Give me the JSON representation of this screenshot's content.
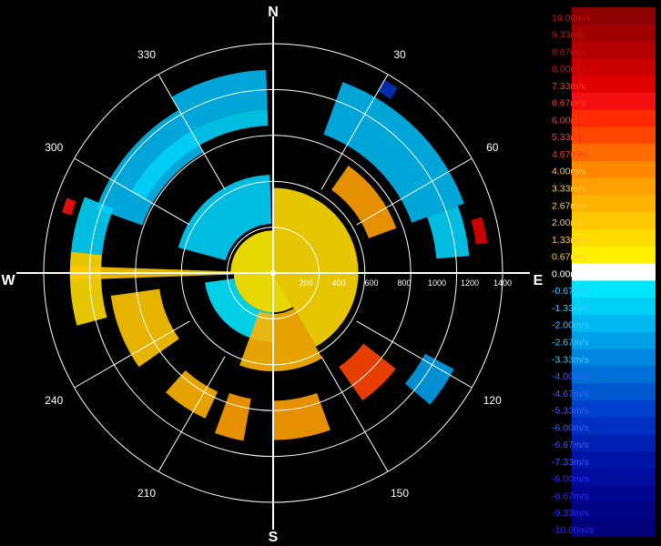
{
  "chart_data": {
    "type": "polar-heatmap",
    "title": "",
    "compass": {
      "north": "N",
      "east": "E",
      "south": "S",
      "west": "W"
    },
    "azimuth_labels": [
      "30",
      "60",
      "120",
      "150",
      "210",
      "240",
      "300",
      "330"
    ],
    "range_labels": [
      "200",
      "400",
      "600",
      "800",
      "1000",
      "1200",
      "1400"
    ],
    "max_range": 1400,
    "unit": "m/s",
    "grid": true,
    "legend": {
      "placement": "right",
      "entries": [
        {
          "label": "10.00m/s",
          "color": "#8b0000"
        },
        {
          "label": "9.33m/s",
          "color": "#a00000"
        },
        {
          "label": "8.67m/s",
          "color": "#b40000"
        },
        {
          "label": "8.00m/s",
          "color": "#cc0000"
        },
        {
          "label": "7.33m/s",
          "color": "#e00000"
        },
        {
          "label": "6.67m/s",
          "color": "#f41010"
        },
        {
          "label": "6.00m/s",
          "color": "#ff2a00"
        },
        {
          "label": "5.33m/s",
          "color": "#ff4500"
        },
        {
          "label": "4.67m/s",
          "color": "#ff6a00"
        },
        {
          "label": "4.00m/s",
          "color": "#ff8800"
        },
        {
          "label": "3.33m/s",
          "color": "#ffa000"
        },
        {
          "label": "2.67m/s",
          "color": "#ffb400"
        },
        {
          "label": "2.00m/s",
          "color": "#ffc800"
        },
        {
          "label": "1.33m/s",
          "color": "#ffdc00"
        },
        {
          "label": "0.67m/s",
          "color": "#fff000"
        },
        {
          "label": "0.00m/s",
          "color": "#ffffff"
        },
        {
          "label": "-0.67m/s",
          "color": "#00e5ff"
        },
        {
          "label": "-1.33m/s",
          "color": "#00d0f8"
        },
        {
          "label": "-2.00m/s",
          "color": "#00b8f0"
        },
        {
          "label": "-2.67m/s",
          "color": "#00a0e8"
        },
        {
          "label": "-3.33m/s",
          "color": "#0088e0"
        },
        {
          "label": "-4.00m/s",
          "color": "#0070d8"
        },
        {
          "label": "-4.67m/s",
          "color": "#0058d0"
        },
        {
          "label": "-5.33m/s",
          "color": "#0040cc"
        },
        {
          "label": "-6.00m/s",
          "color": "#0030c0"
        },
        {
          "label": "-6.67m/s",
          "color": "#0020b4"
        },
        {
          "label": "-7.33m/s",
          "color": "#0014a8"
        },
        {
          "label": "-8.00m/s",
          "color": "#000c9c"
        },
        {
          "label": "-8.67m/s",
          "color": "#000690"
        },
        {
          "label": "-9.33m/s",
          "color": "#000384"
        },
        {
          "label": "-10.00m/s",
          "color": "#000078"
        }
      ]
    },
    "sectors": [
      {
        "az_start": 330,
        "az_end": 358,
        "r_start": 1000,
        "r_end": 1240,
        "value": -2.0
      },
      {
        "az_start": 290,
        "az_end": 330,
        "r_start": 850,
        "r_end": 1150,
        "value": -2.0
      },
      {
        "az_start": 300,
        "az_end": 358,
        "r_start": 900,
        "r_end": 1000,
        "value": -1.33
      },
      {
        "az_start": 276,
        "az_end": 292,
        "r_start": 1050,
        "r_end": 1240,
        "value": -1.33
      },
      {
        "az_start": 255,
        "az_end": 276,
        "r_start": 1050,
        "r_end": 1240,
        "value": 1.33
      },
      {
        "az_start": 268,
        "az_end": 272,
        "r_start": 0,
        "r_end": 1240,
        "value": 2.0
      },
      {
        "az_start": 235,
        "az_end": 262,
        "r_start": 700,
        "r_end": 1000,
        "value": 2.0
      },
      {
        "az_start": 20,
        "az_end": 70,
        "r_start": 900,
        "r_end": 1240,
        "value": -2.0
      },
      {
        "az_start": 70,
        "az_end": 85,
        "r_start": 1000,
        "r_end": 1200,
        "value": -1.33
      },
      {
        "az_start": 285,
        "az_end": 358,
        "r_start": 300,
        "r_end": 600,
        "value": -1.33
      },
      {
        "az_start": 0,
        "az_end": 150,
        "r_start": 0,
        "r_end": 520,
        "value": 1.33
      },
      {
        "az_start": 150,
        "az_end": 270,
        "r_start": 0,
        "r_end": 240,
        "value": 0.67
      },
      {
        "az_start": 270,
        "az_end": 360,
        "r_start": 0,
        "r_end": 260,
        "value": 0.67
      },
      {
        "az_start": 180,
        "az_end": 262,
        "r_start": 240,
        "r_end": 420,
        "value": -0.67
      },
      {
        "az_start": 150,
        "az_end": 200,
        "r_start": 250,
        "r_end": 600,
        "value": 2.67
      },
      {
        "az_start": 190,
        "az_end": 200,
        "r_start": 780,
        "r_end": 1040,
        "value": 3.33
      },
      {
        "az_start": 160,
        "az_end": 180,
        "r_start": 780,
        "r_end": 1020,
        "value": 3.33
      },
      {
        "az_start": 205,
        "az_end": 222,
        "r_start": 800,
        "r_end": 980,
        "value": 2.67
      },
      {
        "az_start": 128,
        "az_end": 145,
        "r_start": 700,
        "r_end": 950,
        "value": 5.33
      },
      {
        "az_start": 118,
        "az_end": 130,
        "r_start": 1050,
        "r_end": 1250,
        "value": -2.67
      },
      {
        "az_start": 75,
        "az_end": 82,
        "r_start": 1250,
        "r_end": 1320,
        "value": 7.33
      },
      {
        "az_start": 30,
        "az_end": 34,
        "r_start": 1280,
        "r_end": 1360,
        "value": -6.0
      },
      {
        "az_start": 286,
        "az_end": 290,
        "r_start": 1280,
        "r_end": 1340,
        "value": 6.67
      },
      {
        "az_start": 35,
        "az_end": 70,
        "r_start": 620,
        "r_end": 800,
        "value": 3.33
      }
    ]
  }
}
